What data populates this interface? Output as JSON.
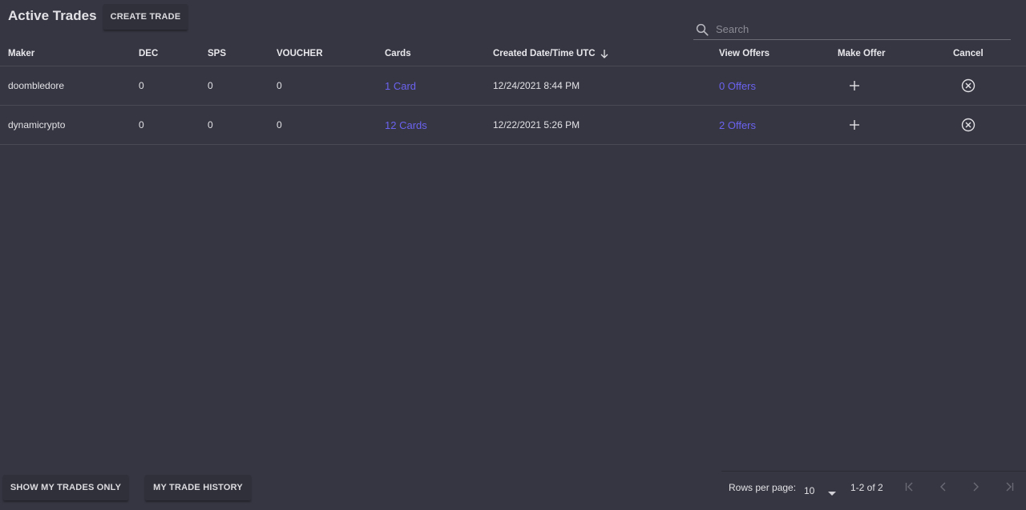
{
  "header": {
    "title": "Active Trades",
    "create_button": "CREATE TRADE"
  },
  "search": {
    "placeholder": "Search",
    "value": "",
    "icon": "search-icon"
  },
  "table": {
    "columns": {
      "maker": "Maker",
      "dec": "DEC",
      "sps": "SPS",
      "voucher": "VOUCHER",
      "cards": "Cards",
      "created": "Created Date/Time UTC",
      "view_offers": "View Offers",
      "make_offer": "Make Offer",
      "cancel": "Cancel"
    },
    "sort": {
      "column": "created",
      "direction": "descending",
      "icon": "arrow-down-icon"
    },
    "rows": [
      {
        "maker": "doombledore",
        "dec": "0",
        "sps": "0",
        "voucher": "0",
        "cards": "1 Card",
        "created": "12/24/2021 8:44 PM",
        "offers": "0 Offers"
      },
      {
        "maker": "dynamicrypto",
        "dec": "0",
        "sps": "0",
        "voucher": "0",
        "cards": "12 Cards",
        "created": "12/22/2021 5:26 PM",
        "offers": "2 Offers"
      }
    ]
  },
  "footer": {
    "show_mine_button": "SHOW MY TRADES ONLY",
    "history_button": "MY TRADE HISTORY"
  },
  "pagination": {
    "rows_per_page_label": "Rows per page:",
    "rows_per_page_value": "10",
    "range": "1-2 of 2"
  },
  "colors": {
    "background": "#363642",
    "link": "#6b63f0",
    "button_bg": "#30303a",
    "divider": "#4a4a55"
  }
}
